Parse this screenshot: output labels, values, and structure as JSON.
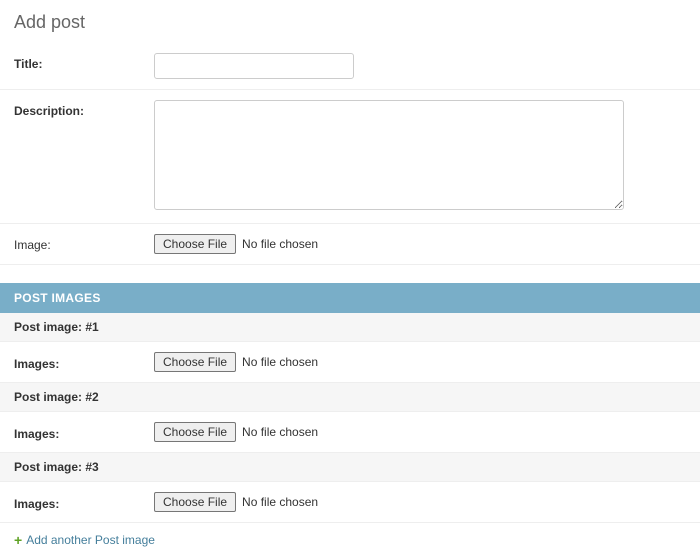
{
  "page": {
    "title": "Add post"
  },
  "fields": {
    "title_label": "Title:",
    "title_value": "",
    "description_label": "Description:",
    "description_value": "",
    "image_label": "Image:",
    "file_button": "Choose File",
    "file_status": "No file chosen"
  },
  "inline": {
    "section_header": "POST IMAGES",
    "images_label": "Images:",
    "forms": [
      {
        "header": "Post image: #1"
      },
      {
        "header": "Post image: #2"
      },
      {
        "header": "Post image: #3"
      }
    ],
    "add_another": "Add another Post image"
  }
}
